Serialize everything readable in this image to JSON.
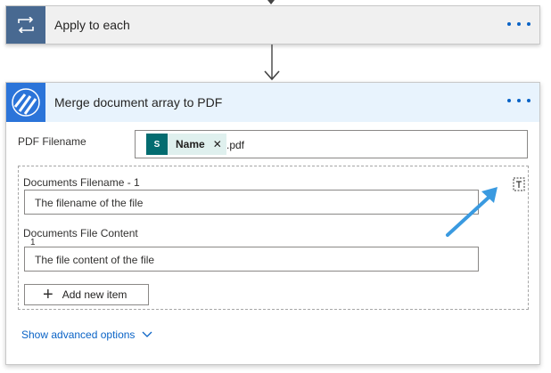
{
  "apply_each": {
    "title": "Apply to each",
    "icon": "loop-icon",
    "accent": "#486991"
  },
  "merge_action": {
    "title": "Merge document array to PDF",
    "icon": "encodian-stripes-icon",
    "accent": "#2b74d9",
    "header_bg": "#e8f3fd"
  },
  "fields": {
    "pdf_filename": {
      "label": "PDF Filename",
      "token": {
        "label": "Name",
        "icon": "sharepoint-icon",
        "icon_text": "S"
      },
      "suffix": ".pdf"
    },
    "documents_filename": {
      "label": "Documents Filename - 1",
      "placeholder": "The filename of the file"
    },
    "documents_content": {
      "label": "Documents File Content",
      "sublabel": "1",
      "placeholder": "The file content of the file"
    }
  },
  "buttons": {
    "add_new_item": "Add new item",
    "remove_item_icon": "delete-item-icon"
  },
  "links": {
    "show_advanced": "Show advanced options"
  },
  "annotation": {
    "color": "#3a9ae0",
    "icon": "callout-arrow-icon"
  }
}
